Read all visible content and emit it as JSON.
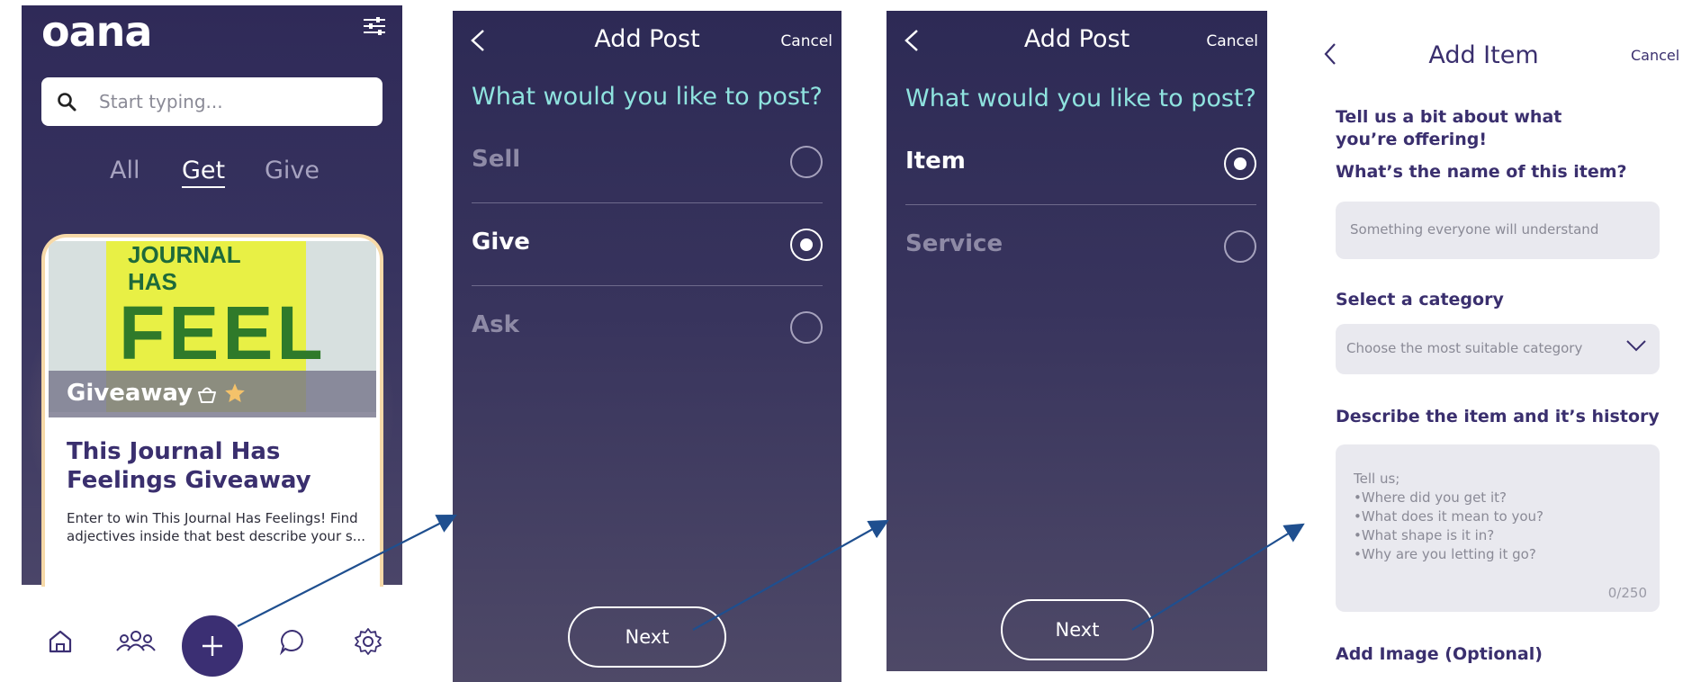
{
  "home": {
    "logo": "oana",
    "search_placeholder": "Start typing...",
    "tabs": [
      {
        "label": "All",
        "active": false
      },
      {
        "label": "Get",
        "active": true
      },
      {
        "label": "Give",
        "active": false
      }
    ],
    "card": {
      "image_text_top": "JOURNAL\nHAS",
      "image_text_big": "FEEL",
      "badge": "Giveaway",
      "title": "This Journal Has Feelings Giveaway",
      "description": "Enter to win This Journal Has Feelings! Find adjectives inside that best describe your s..."
    },
    "nav": [
      "home-icon",
      "people-icon",
      "plus-icon",
      "chat-icon",
      "settings-icon"
    ]
  },
  "post_type": {
    "title": "Add Post",
    "cancel": "Cancel",
    "question": "What would you like to post?",
    "options": [
      {
        "label": "Sell",
        "selected": false
      },
      {
        "label": "Give",
        "selected": true
      },
      {
        "label": "Ask",
        "selected": false
      }
    ],
    "next": "Next"
  },
  "give_type": {
    "title": "Add Post",
    "cancel": "Cancel",
    "question": "What would you like to post?",
    "options": [
      {
        "label": "Item",
        "selected": true
      },
      {
        "label": "Service",
        "selected": false
      }
    ],
    "next": "Next"
  },
  "add_item": {
    "title": "Add Item",
    "cancel": "Cancel",
    "intro": "Tell us a bit about what you’re offering!",
    "name_label": "What’s the name of this item?",
    "name_placeholder": "Something everyone will understand",
    "category_label": "Select a category",
    "category_placeholder": "Choose the most suitable category",
    "describe_label": "Describe the item and it’s history",
    "describe_placeholder": "Tell us;\n•Where did you get it?\n•What does it mean to you?\n•What shape is it in?\n•Why are you letting it go?",
    "counter": "0/250",
    "image_label": "Add Image (Optional)"
  },
  "colors": {
    "dark_bg": "#2d2a55",
    "accent_teal": "#8fe3df",
    "brand_purple": "#3b2f73",
    "arrow": "#1f4f8f"
  }
}
